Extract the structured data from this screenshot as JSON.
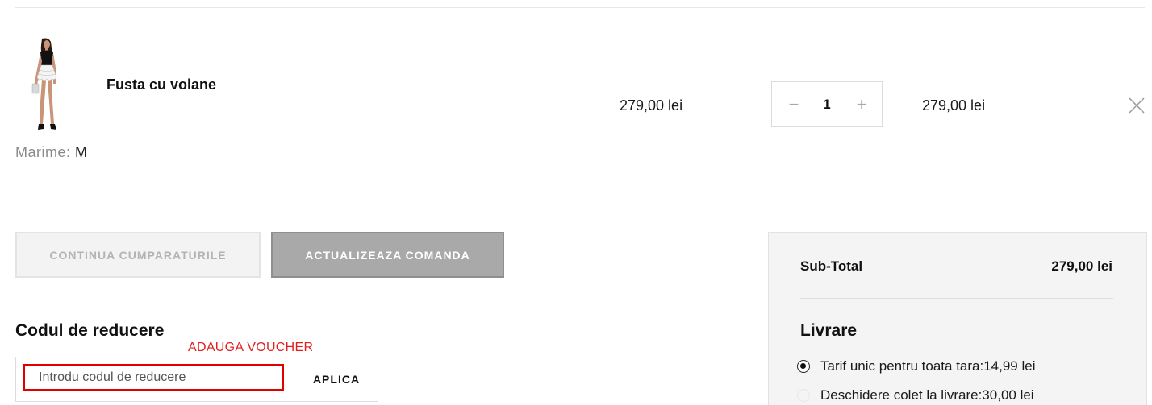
{
  "cart_item": {
    "name": "Fusta cu volane",
    "size_label": "Marime:",
    "size_value": "M",
    "unit_price": "279,00 lei",
    "quantity": "1",
    "line_total": "279,00 lei",
    "minus_symbol": "−",
    "plus_symbol": "+"
  },
  "actions": {
    "continue_label": "CONTINUA CUMPARATURILE",
    "update_label": "ACTUALIZEAZA COMANDA"
  },
  "discount": {
    "title": "Codul de reducere",
    "annotation": "ADAUGA VOUCHER",
    "placeholder": "Introdu codul de reducere",
    "apply_label": "APLICA"
  },
  "summary": {
    "subtotal_label": "Sub-Total",
    "subtotal_value": "279,00 lei",
    "shipping_title": "Livrare",
    "shipping_options": [
      {
        "label": "Tarif unic pentru toata tara:14,99 lei",
        "selected": true
      },
      {
        "label": "Deschidere colet la livrare:30,00 lei",
        "selected": false
      }
    ]
  },
  "colors": {
    "annotation_red": "#e10000",
    "update_button_bg": "#a9a9a9",
    "summary_bg": "#f4f4f4"
  }
}
